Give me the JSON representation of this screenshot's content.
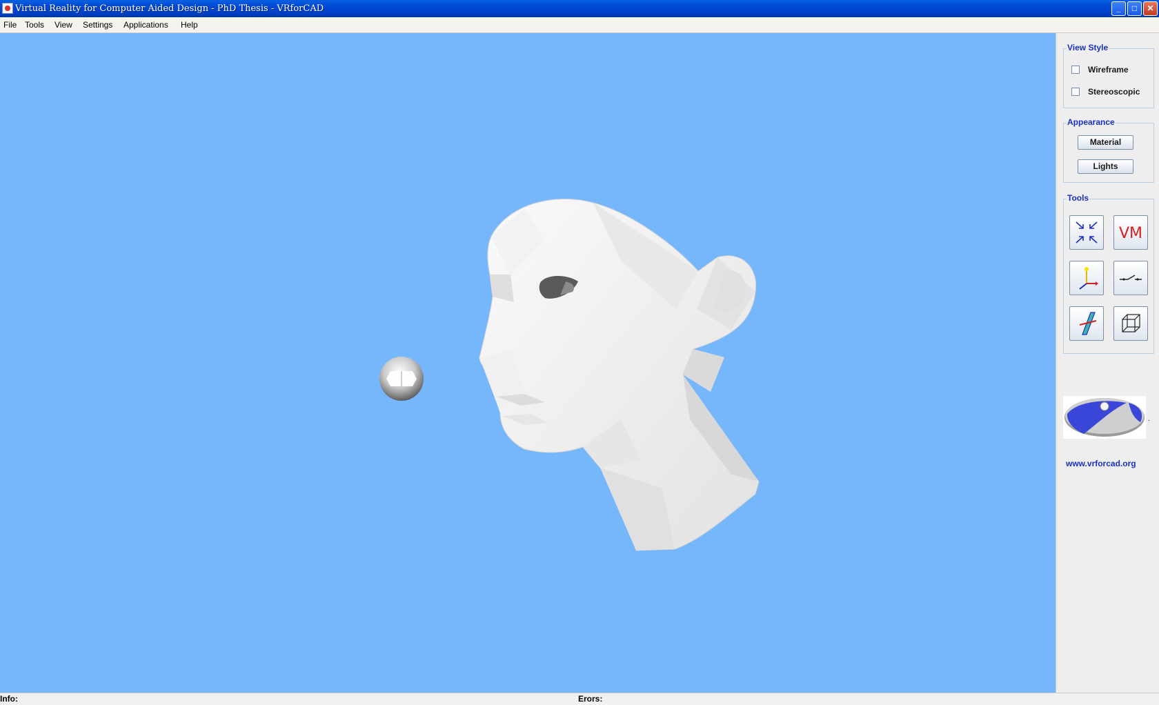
{
  "window": {
    "title": "Virtual Reality for Computer Aided Design - PhD Thesis  - VRforCAD",
    "controls": {
      "minimize": "_",
      "maximize": "□",
      "close": "✕"
    }
  },
  "menubar": {
    "items": [
      "File",
      "Tools",
      "View",
      "Settings",
      "Applications",
      "Help"
    ]
  },
  "viewport": {
    "background": "#76b7fb",
    "objects": [
      "head-model",
      "light-sphere"
    ]
  },
  "sidepanel": {
    "view_style": {
      "title": "View Style",
      "options": [
        {
          "label": "Wireframe",
          "checked": false
        },
        {
          "label": "Stereoscopic",
          "checked": false
        }
      ]
    },
    "appearance": {
      "title": "Appearance",
      "buttons": [
        "Material",
        "Lights"
      ]
    },
    "tools": {
      "title": "Tools",
      "icons": [
        "zoom-fit-icon",
        "vm-icon",
        "axes-icon",
        "edge-switch-icon",
        "plane-section-icon",
        "cube-icon"
      ],
      "vm_text": "VM"
    },
    "logo_dot": ".",
    "site_link": "www.vrforcad.org"
  },
  "statusbar": {
    "info_label": "Info:",
    "errors_label": "Erors:"
  },
  "colors": {
    "accent_text": "#1a2fc8",
    "title_bar": "#0048d6"
  }
}
